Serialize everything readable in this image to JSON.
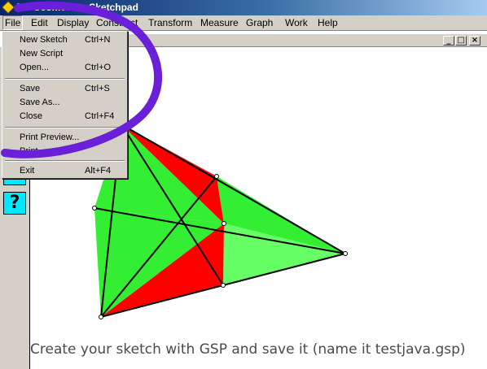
{
  "window": {
    "title": "T... Geometer's Sketchpad"
  },
  "menubar": {
    "items": [
      {
        "label": "File"
      },
      {
        "label": "Edit"
      },
      {
        "label": "Display"
      },
      {
        "label": "Construct"
      },
      {
        "label": "Transform"
      },
      {
        "label": "Measure"
      },
      {
        "label": "Graph"
      },
      {
        "label": "Work"
      },
      {
        "label": "Help"
      }
    ]
  },
  "file_menu": {
    "items": [
      {
        "label": "New Sketch",
        "shortcut": "Ctrl+N"
      },
      {
        "label": "New Script",
        "shortcut": ""
      },
      {
        "label": "Open...",
        "shortcut": "Ctrl+O"
      },
      {
        "label": "Save",
        "shortcut": "Ctrl+S"
      },
      {
        "label": "Save As...",
        "shortcut": ""
      },
      {
        "label": "Close",
        "shortcut": "Ctrl+F4"
      },
      {
        "label": "Print Preview...",
        "shortcut": ""
      },
      {
        "label": "Print...",
        "shortcut": ""
      },
      {
        "label": "Exit",
        "shortcut": "Alt+F4"
      }
    ]
  },
  "doc_window": {
    "minimize": "_",
    "maximize": "□",
    "close": "×"
  },
  "toolbox": {
    "tool_a": "\\H/",
    "tool_b": "?"
  },
  "caption": "Create your sketch with GSP and save it (name it testjava.gsp)",
  "colors": {
    "red_region": "#ff0000",
    "green_dark": "#33ee33",
    "green_light": "#66ff66",
    "annotation": "#6a1fd8",
    "title_bar": "#0a246a"
  }
}
